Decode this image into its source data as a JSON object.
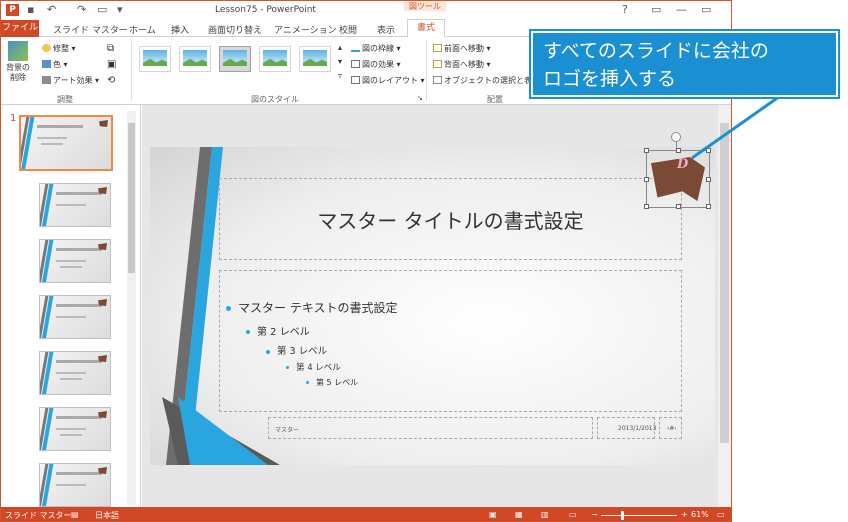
{
  "window": {
    "title": "Lesson75 - PowerPoint",
    "context_tab_group": "図ツール",
    "buttons": [
      "?",
      "▭",
      "—",
      "▭",
      "✕"
    ]
  },
  "tabs": {
    "file": "ファイル",
    "items": [
      "スライド マスター",
      "ホーム",
      "挿入",
      "画面切り替え",
      "アニメーション",
      "校閲",
      "表示"
    ],
    "active": "書式"
  },
  "ribbon": {
    "remove_bg": "背景の\n削除",
    "adjust": {
      "corrections": "修整 ▾",
      "color": "色 ▾",
      "artistic": "アート効果 ▾",
      "label": "調整"
    },
    "picture_styles": {
      "border": "図の枠線 ▾",
      "effects": "図の効果 ▾",
      "layout": "図のレイアウト ▾",
      "label": "図のスタイル"
    },
    "arrange": {
      "bring_forward": "前面へ移動 ▾",
      "send_backward": "背面へ移動 ▾",
      "selection_pane": "オブジェクトの選択と表示",
      "label": "配置"
    }
  },
  "thumbnails": {
    "first_number": "1"
  },
  "slide": {
    "title": "マスター タイトルの書式設定",
    "bullets": [
      {
        "text": "マスター テキストの書式設定",
        "level": 1
      },
      {
        "text": "第 2 レベル",
        "level": 2
      },
      {
        "text": "第 3 レベル",
        "level": 3
      },
      {
        "text": "第 4 レベル",
        "level": 4
      },
      {
        "text": "第 5 レベル",
        "level": 5
      }
    ],
    "footer": "マスター",
    "date": "2013/1/2013",
    "page": "‹#›",
    "logo_letter": "D"
  },
  "status": {
    "view": "スライド マスター",
    "language": "日本語",
    "zoom": "61%",
    "zoom_minus": "−",
    "zoom_plus": "+"
  },
  "callout": {
    "line1": "すべてのスライドに会社の",
    "line2": "ロゴを挿入する"
  },
  "colors": {
    "accent": "#d24726",
    "callout": "#1a8fd1",
    "slide_stripe": "#2aa6df"
  }
}
